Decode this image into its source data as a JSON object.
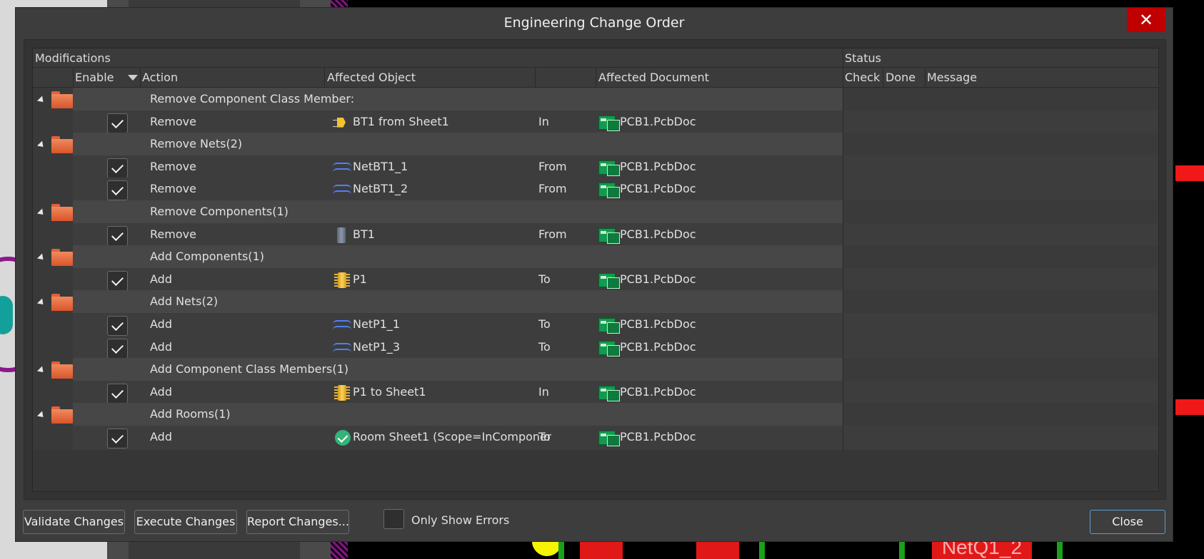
{
  "dialog": {
    "title": "Engineering Change Order",
    "close_glyph": "✕"
  },
  "headers": {
    "modifications": "Modifications",
    "status": "Status",
    "enable": "Enable",
    "action": "Action",
    "affected_object": "Affected Object",
    "affected_document": "Affected Document",
    "check": "Check",
    "done": "Done",
    "message": "Message"
  },
  "rows": [
    {
      "type": "group",
      "label": "Remove Component Class Member:"
    },
    {
      "type": "item",
      "action": "Remove",
      "object_icon": "component-class-icon",
      "object": "BT1 from Sheet1",
      "dir": "In",
      "doc": "PCB1.PcbDoc"
    },
    {
      "type": "group",
      "label": "Remove Nets(2)"
    },
    {
      "type": "item",
      "action": "Remove",
      "object_icon": "net-icon",
      "object": "NetBT1_1",
      "dir": "From",
      "doc": "PCB1.PcbDoc"
    },
    {
      "type": "item",
      "action": "Remove",
      "object_icon": "net-icon",
      "object": "NetBT1_2",
      "dir": "From",
      "doc": "PCB1.PcbDoc"
    },
    {
      "type": "group",
      "label": "Remove Components(1)"
    },
    {
      "type": "item",
      "action": "Remove",
      "object_icon": "component-grey-icon",
      "object": "BT1",
      "dir": "From",
      "doc": "PCB1.PcbDoc"
    },
    {
      "type": "group",
      "label": "Add Components(1)"
    },
    {
      "type": "item",
      "action": "Add",
      "object_icon": "component-yellow-icon",
      "object": "P1",
      "dir": "To",
      "doc": "PCB1.PcbDoc"
    },
    {
      "type": "group",
      "label": "Add Nets(2)"
    },
    {
      "type": "item",
      "action": "Add",
      "object_icon": "net-icon",
      "object": "NetP1_1",
      "dir": "To",
      "doc": "PCB1.PcbDoc"
    },
    {
      "type": "item",
      "action": "Add",
      "object_icon": "net-icon",
      "object": "NetP1_3",
      "dir": "To",
      "doc": "PCB1.PcbDoc"
    },
    {
      "type": "group",
      "label": "Add Component Class Members(1)"
    },
    {
      "type": "item",
      "action": "Add",
      "object_icon": "component-yellow-icon",
      "object": "P1 to Sheet1",
      "dir": "In",
      "doc": "PCB1.PcbDoc"
    },
    {
      "type": "group",
      "label": "Add Rooms(1)"
    },
    {
      "type": "item",
      "action": "Add",
      "object_icon": "room-icon",
      "object": "Room Sheet1 (Scope=InComponent",
      "dir": "To",
      "doc": "PCB1.PcbDoc"
    }
  ],
  "buttons": {
    "validate": "Validate Changes",
    "execute": "Execute Changes",
    "report": "Report Changes...",
    "only_show_errors": "Only Show Errors",
    "close": "Close"
  },
  "background": {
    "net_label": "NetQ1_2"
  }
}
